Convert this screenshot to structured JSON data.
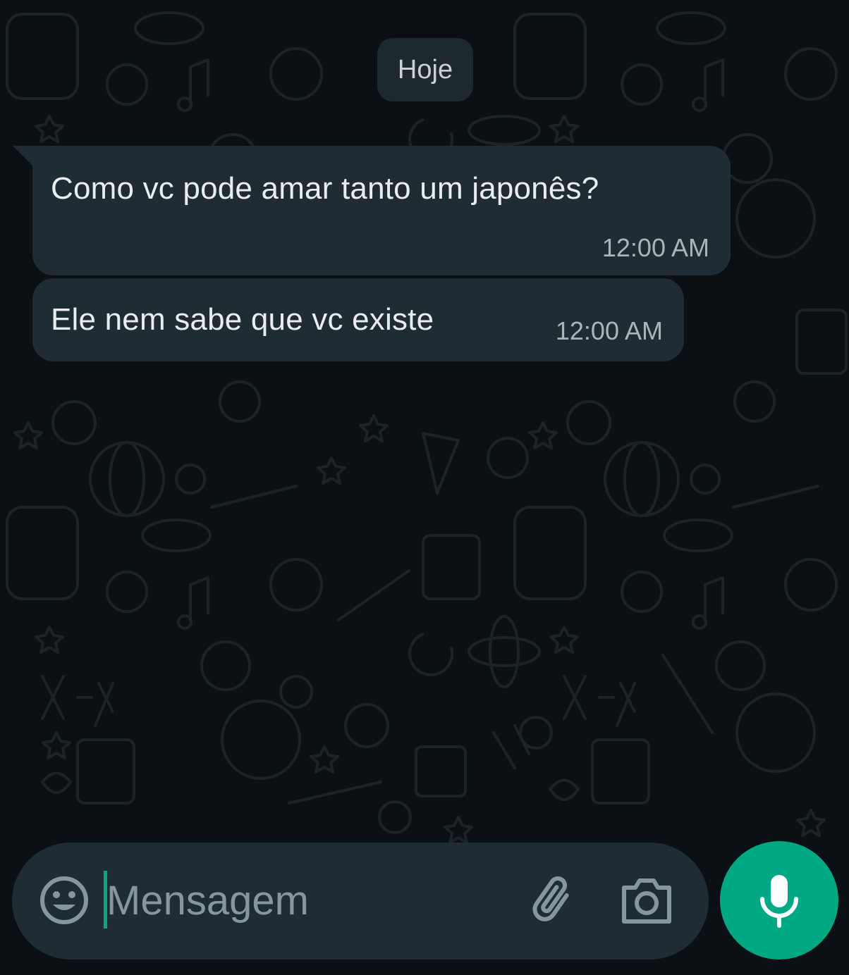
{
  "chat": {
    "date_label": "Hoje",
    "messages": [
      {
        "text": "Como vc pode amar tanto um japonês?",
        "time": "12:00 AM"
      },
      {
        "text": "Ele nem sabe que vc existe",
        "time": "12:00 AM"
      }
    ]
  },
  "composer": {
    "placeholder": "Mensagem",
    "emoji_icon": "smiley-icon",
    "attach_icon": "paperclip-icon",
    "camera_icon": "camera-icon",
    "mic_icon": "microphone-icon"
  },
  "colors": {
    "background": "#0b1014",
    "bubble": "#1f2c34",
    "accent": "#00a884",
    "text": "#e9edef",
    "muted": "#aab4b9"
  }
}
